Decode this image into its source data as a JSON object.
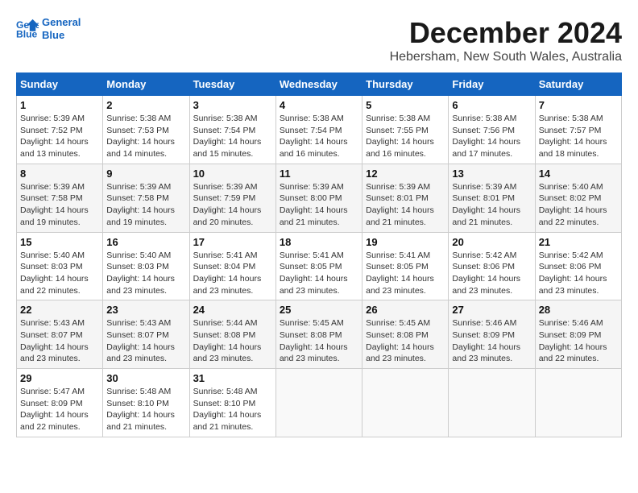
{
  "logo": {
    "line1": "General",
    "line2": "Blue"
  },
  "title": "December 2024",
  "subtitle": "Hebersham, New South Wales, Australia",
  "weekdays": [
    "Sunday",
    "Monday",
    "Tuesday",
    "Wednesday",
    "Thursday",
    "Friday",
    "Saturday"
  ],
  "weeks": [
    [
      {
        "day": "1",
        "info": "Sunrise: 5:39 AM\nSunset: 7:52 PM\nDaylight: 14 hours\nand 13 minutes."
      },
      {
        "day": "2",
        "info": "Sunrise: 5:38 AM\nSunset: 7:53 PM\nDaylight: 14 hours\nand 14 minutes."
      },
      {
        "day": "3",
        "info": "Sunrise: 5:38 AM\nSunset: 7:54 PM\nDaylight: 14 hours\nand 15 minutes."
      },
      {
        "day": "4",
        "info": "Sunrise: 5:38 AM\nSunset: 7:54 PM\nDaylight: 14 hours\nand 16 minutes."
      },
      {
        "day": "5",
        "info": "Sunrise: 5:38 AM\nSunset: 7:55 PM\nDaylight: 14 hours\nand 16 minutes."
      },
      {
        "day": "6",
        "info": "Sunrise: 5:38 AM\nSunset: 7:56 PM\nDaylight: 14 hours\nand 17 minutes."
      },
      {
        "day": "7",
        "info": "Sunrise: 5:38 AM\nSunset: 7:57 PM\nDaylight: 14 hours\nand 18 minutes."
      }
    ],
    [
      {
        "day": "8",
        "info": "Sunrise: 5:39 AM\nSunset: 7:58 PM\nDaylight: 14 hours\nand 19 minutes."
      },
      {
        "day": "9",
        "info": "Sunrise: 5:39 AM\nSunset: 7:58 PM\nDaylight: 14 hours\nand 19 minutes."
      },
      {
        "day": "10",
        "info": "Sunrise: 5:39 AM\nSunset: 7:59 PM\nDaylight: 14 hours\nand 20 minutes."
      },
      {
        "day": "11",
        "info": "Sunrise: 5:39 AM\nSunset: 8:00 PM\nDaylight: 14 hours\nand 21 minutes."
      },
      {
        "day": "12",
        "info": "Sunrise: 5:39 AM\nSunset: 8:01 PM\nDaylight: 14 hours\nand 21 minutes."
      },
      {
        "day": "13",
        "info": "Sunrise: 5:39 AM\nSunset: 8:01 PM\nDaylight: 14 hours\nand 21 minutes."
      },
      {
        "day": "14",
        "info": "Sunrise: 5:40 AM\nSunset: 8:02 PM\nDaylight: 14 hours\nand 22 minutes."
      }
    ],
    [
      {
        "day": "15",
        "info": "Sunrise: 5:40 AM\nSunset: 8:03 PM\nDaylight: 14 hours\nand 22 minutes."
      },
      {
        "day": "16",
        "info": "Sunrise: 5:40 AM\nSunset: 8:03 PM\nDaylight: 14 hours\nand 23 minutes."
      },
      {
        "day": "17",
        "info": "Sunrise: 5:41 AM\nSunset: 8:04 PM\nDaylight: 14 hours\nand 23 minutes."
      },
      {
        "day": "18",
        "info": "Sunrise: 5:41 AM\nSunset: 8:05 PM\nDaylight: 14 hours\nand 23 minutes."
      },
      {
        "day": "19",
        "info": "Sunrise: 5:41 AM\nSunset: 8:05 PM\nDaylight: 14 hours\nand 23 minutes."
      },
      {
        "day": "20",
        "info": "Sunrise: 5:42 AM\nSunset: 8:06 PM\nDaylight: 14 hours\nand 23 minutes."
      },
      {
        "day": "21",
        "info": "Sunrise: 5:42 AM\nSunset: 8:06 PM\nDaylight: 14 hours\nand 23 minutes."
      }
    ],
    [
      {
        "day": "22",
        "info": "Sunrise: 5:43 AM\nSunset: 8:07 PM\nDaylight: 14 hours\nand 23 minutes."
      },
      {
        "day": "23",
        "info": "Sunrise: 5:43 AM\nSunset: 8:07 PM\nDaylight: 14 hours\nand 23 minutes."
      },
      {
        "day": "24",
        "info": "Sunrise: 5:44 AM\nSunset: 8:08 PM\nDaylight: 14 hours\nand 23 minutes."
      },
      {
        "day": "25",
        "info": "Sunrise: 5:45 AM\nSunset: 8:08 PM\nDaylight: 14 hours\nand 23 minutes."
      },
      {
        "day": "26",
        "info": "Sunrise: 5:45 AM\nSunset: 8:08 PM\nDaylight: 14 hours\nand 23 minutes."
      },
      {
        "day": "27",
        "info": "Sunrise: 5:46 AM\nSunset: 8:09 PM\nDaylight: 14 hours\nand 23 minutes."
      },
      {
        "day": "28",
        "info": "Sunrise: 5:46 AM\nSunset: 8:09 PM\nDaylight: 14 hours\nand 22 minutes."
      }
    ],
    [
      {
        "day": "29",
        "info": "Sunrise: 5:47 AM\nSunset: 8:09 PM\nDaylight: 14 hours\nand 22 minutes."
      },
      {
        "day": "30",
        "info": "Sunrise: 5:48 AM\nSunset: 8:10 PM\nDaylight: 14 hours\nand 21 minutes."
      },
      {
        "day": "31",
        "info": "Sunrise: 5:48 AM\nSunset: 8:10 PM\nDaylight: 14 hours\nand 21 minutes."
      },
      null,
      null,
      null,
      null
    ]
  ]
}
